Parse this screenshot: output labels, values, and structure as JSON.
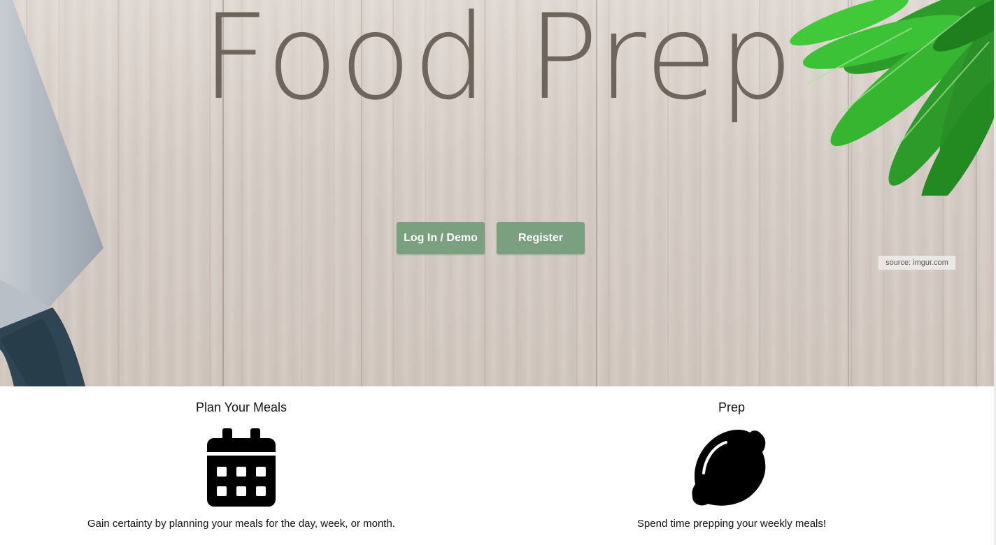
{
  "hero": {
    "title": "Food Prep",
    "login_label": "Log In / Demo",
    "register_label": "Register",
    "source_credit": "source: imgur.com"
  },
  "features": [
    {
      "heading": "Plan Your Meals",
      "icon": "calendar-icon",
      "description": "Gain certainty by planning your meals for the day, week, or month."
    },
    {
      "heading": "Prep",
      "icon": "lemon-icon",
      "description": "Spend time prepping your weekly meals!"
    }
  ],
  "colors": {
    "button": "#7ba07f",
    "title": "#6e665d",
    "icon": "#000000"
  }
}
